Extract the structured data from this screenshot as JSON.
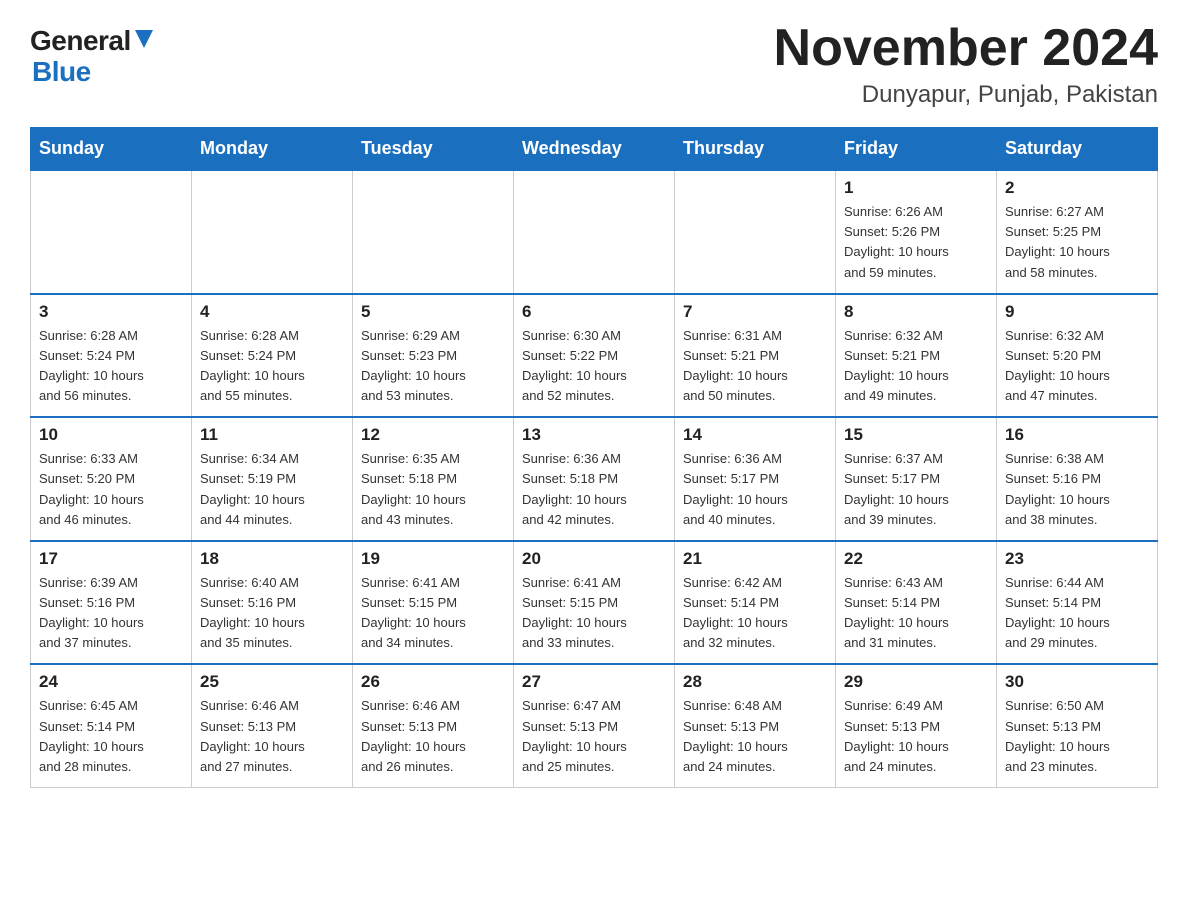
{
  "logo": {
    "general": "General",
    "blue": "Blue"
  },
  "title": "November 2024",
  "subtitle": "Dunyapur, Punjab, Pakistan",
  "headers": [
    "Sunday",
    "Monday",
    "Tuesday",
    "Wednesday",
    "Thursday",
    "Friday",
    "Saturday"
  ],
  "weeks": [
    [
      {
        "day": "",
        "info": ""
      },
      {
        "day": "",
        "info": ""
      },
      {
        "day": "",
        "info": ""
      },
      {
        "day": "",
        "info": ""
      },
      {
        "day": "",
        "info": ""
      },
      {
        "day": "1",
        "info": "Sunrise: 6:26 AM\nSunset: 5:26 PM\nDaylight: 10 hours\nand 59 minutes."
      },
      {
        "day": "2",
        "info": "Sunrise: 6:27 AM\nSunset: 5:25 PM\nDaylight: 10 hours\nand 58 minutes."
      }
    ],
    [
      {
        "day": "3",
        "info": "Sunrise: 6:28 AM\nSunset: 5:24 PM\nDaylight: 10 hours\nand 56 minutes."
      },
      {
        "day": "4",
        "info": "Sunrise: 6:28 AM\nSunset: 5:24 PM\nDaylight: 10 hours\nand 55 minutes."
      },
      {
        "day": "5",
        "info": "Sunrise: 6:29 AM\nSunset: 5:23 PM\nDaylight: 10 hours\nand 53 minutes."
      },
      {
        "day": "6",
        "info": "Sunrise: 6:30 AM\nSunset: 5:22 PM\nDaylight: 10 hours\nand 52 minutes."
      },
      {
        "day": "7",
        "info": "Sunrise: 6:31 AM\nSunset: 5:21 PM\nDaylight: 10 hours\nand 50 minutes."
      },
      {
        "day": "8",
        "info": "Sunrise: 6:32 AM\nSunset: 5:21 PM\nDaylight: 10 hours\nand 49 minutes."
      },
      {
        "day": "9",
        "info": "Sunrise: 6:32 AM\nSunset: 5:20 PM\nDaylight: 10 hours\nand 47 minutes."
      }
    ],
    [
      {
        "day": "10",
        "info": "Sunrise: 6:33 AM\nSunset: 5:20 PM\nDaylight: 10 hours\nand 46 minutes."
      },
      {
        "day": "11",
        "info": "Sunrise: 6:34 AM\nSunset: 5:19 PM\nDaylight: 10 hours\nand 44 minutes."
      },
      {
        "day": "12",
        "info": "Sunrise: 6:35 AM\nSunset: 5:18 PM\nDaylight: 10 hours\nand 43 minutes."
      },
      {
        "day": "13",
        "info": "Sunrise: 6:36 AM\nSunset: 5:18 PM\nDaylight: 10 hours\nand 42 minutes."
      },
      {
        "day": "14",
        "info": "Sunrise: 6:36 AM\nSunset: 5:17 PM\nDaylight: 10 hours\nand 40 minutes."
      },
      {
        "day": "15",
        "info": "Sunrise: 6:37 AM\nSunset: 5:17 PM\nDaylight: 10 hours\nand 39 minutes."
      },
      {
        "day": "16",
        "info": "Sunrise: 6:38 AM\nSunset: 5:16 PM\nDaylight: 10 hours\nand 38 minutes."
      }
    ],
    [
      {
        "day": "17",
        "info": "Sunrise: 6:39 AM\nSunset: 5:16 PM\nDaylight: 10 hours\nand 37 minutes."
      },
      {
        "day": "18",
        "info": "Sunrise: 6:40 AM\nSunset: 5:16 PM\nDaylight: 10 hours\nand 35 minutes."
      },
      {
        "day": "19",
        "info": "Sunrise: 6:41 AM\nSunset: 5:15 PM\nDaylight: 10 hours\nand 34 minutes."
      },
      {
        "day": "20",
        "info": "Sunrise: 6:41 AM\nSunset: 5:15 PM\nDaylight: 10 hours\nand 33 minutes."
      },
      {
        "day": "21",
        "info": "Sunrise: 6:42 AM\nSunset: 5:14 PM\nDaylight: 10 hours\nand 32 minutes."
      },
      {
        "day": "22",
        "info": "Sunrise: 6:43 AM\nSunset: 5:14 PM\nDaylight: 10 hours\nand 31 minutes."
      },
      {
        "day": "23",
        "info": "Sunrise: 6:44 AM\nSunset: 5:14 PM\nDaylight: 10 hours\nand 29 minutes."
      }
    ],
    [
      {
        "day": "24",
        "info": "Sunrise: 6:45 AM\nSunset: 5:14 PM\nDaylight: 10 hours\nand 28 minutes."
      },
      {
        "day": "25",
        "info": "Sunrise: 6:46 AM\nSunset: 5:13 PM\nDaylight: 10 hours\nand 27 minutes."
      },
      {
        "day": "26",
        "info": "Sunrise: 6:46 AM\nSunset: 5:13 PM\nDaylight: 10 hours\nand 26 minutes."
      },
      {
        "day": "27",
        "info": "Sunrise: 6:47 AM\nSunset: 5:13 PM\nDaylight: 10 hours\nand 25 minutes."
      },
      {
        "day": "28",
        "info": "Sunrise: 6:48 AM\nSunset: 5:13 PM\nDaylight: 10 hours\nand 24 minutes."
      },
      {
        "day": "29",
        "info": "Sunrise: 6:49 AM\nSunset: 5:13 PM\nDaylight: 10 hours\nand 24 minutes."
      },
      {
        "day": "30",
        "info": "Sunrise: 6:50 AM\nSunset: 5:13 PM\nDaylight: 10 hours\nand 23 minutes."
      }
    ]
  ]
}
